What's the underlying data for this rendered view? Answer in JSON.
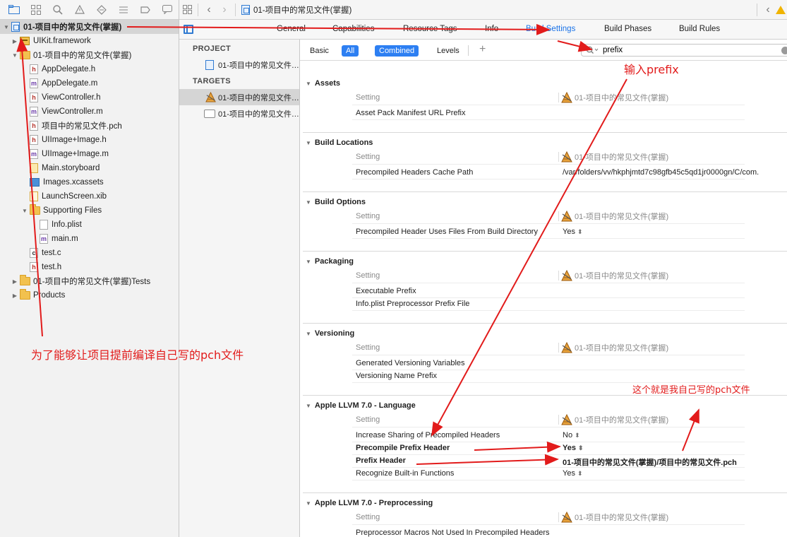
{
  "navigator": {
    "project_name": "01-项目中的常见文件(掌握)",
    "items": [
      {
        "label": "01-项目中的常见文件(掌握)",
        "type": "project",
        "disclosure": "▼",
        "selected": true
      },
      {
        "label": "UIKit.framework",
        "type": "framework",
        "disclosure": "▶"
      },
      {
        "label": "01-项目中的常见文件(掌握)",
        "type": "folder",
        "disclosure": "▼"
      },
      {
        "label": "AppDelegate.h",
        "type": "h"
      },
      {
        "label": "AppDelegate.m",
        "type": "m"
      },
      {
        "label": "ViewController.h",
        "type": "h"
      },
      {
        "label": "ViewController.m",
        "type": "m"
      },
      {
        "label": "项目中的常见文件.pch",
        "type": "h"
      },
      {
        "label": "UIImage+Image.h",
        "type": "h"
      },
      {
        "label": "UIImage+Image.m",
        "type": "m"
      },
      {
        "label": "Main.storyboard",
        "type": "storyboard"
      },
      {
        "label": "Images.xcassets",
        "type": "assets"
      },
      {
        "label": "LaunchScreen.xib",
        "type": "xib"
      },
      {
        "label": "Supporting Files",
        "type": "folder",
        "disclosure": "▼"
      },
      {
        "label": "Info.plist",
        "type": "plist"
      },
      {
        "label": "main.m",
        "type": "m"
      },
      {
        "label": "test.c",
        "type": "c"
      },
      {
        "label": "test.h",
        "type": "h"
      },
      {
        "label": "01-项目中的常见文件(掌握)Tests",
        "type": "folder",
        "disclosure": "▶"
      },
      {
        "label": "Products",
        "type": "folder",
        "disclosure": "▶"
      }
    ]
  },
  "jump_bar": {
    "path": "01-项目中的常见文件(掌握)"
  },
  "tabs": [
    "General",
    "Capabilities",
    "Resource Tags",
    "Info",
    "Build Settings",
    "Build Phases",
    "Build Rules"
  ],
  "targets_panel": {
    "project_header": "PROJECT",
    "project_item": "01-项目中的常见文件(...",
    "targets_header": "TARGETS",
    "target_items": [
      "01-项目中的常见文件(...",
      "01-项目中的常见文件(..."
    ]
  },
  "filter_bar": {
    "basic": "Basic",
    "all": "All",
    "combined": "Combined",
    "levels": "Levels",
    "plus": "+",
    "search_value": "prefix"
  },
  "settings": {
    "col_setting": "Setting",
    "col_target": "01-项目中的常见文件(掌握)",
    "sections": [
      {
        "title": "Assets",
        "rows": [
          {
            "name": "Asset Pack Manifest URL Prefix",
            "value": ""
          }
        ]
      },
      {
        "title": "Build Locations",
        "rows": [
          {
            "name": "Precompiled Headers Cache Path",
            "value": "/var/folders/vv/hkphjmtd7c98gfb45c5qd1jr0000gn/C/com."
          }
        ]
      },
      {
        "title": "Build Options",
        "rows": [
          {
            "name": "Precompiled Header Uses Files From Build Directory",
            "value": "Yes"
          }
        ]
      },
      {
        "title": "Packaging",
        "rows": [
          {
            "name": "Executable Prefix",
            "value": ""
          },
          {
            "name": "Info.plist Preprocessor Prefix File",
            "value": ""
          }
        ]
      },
      {
        "title": "Versioning",
        "rows": [
          {
            "name": "Generated Versioning Variables",
            "value": ""
          },
          {
            "name": "Versioning Name Prefix",
            "value": ""
          }
        ]
      },
      {
        "title": "Apple LLVM 7.0 - Language",
        "rows": [
          {
            "name": "Increase Sharing of Precompiled Headers",
            "value": "No"
          },
          {
            "name": "Precompile Prefix Header",
            "value": "Yes",
            "bold": true
          },
          {
            "name": "Prefix Header",
            "value": "01-项目中的常见文件(掌握)/项目中的常见文件.pch",
            "bold": true
          },
          {
            "name": "Recognize Built-in Functions",
            "value": "Yes"
          }
        ]
      },
      {
        "title": "Apple LLVM 7.0 - Preprocessing",
        "rows": [
          {
            "name": "Preprocessor Macros Not Used In Precompiled Headers",
            "value": ""
          }
        ]
      }
    ]
  },
  "annotations": {
    "input_prefix": "输入prefix",
    "reason": "为了能够让项目提前编译自己写的pch文件",
    "own_pch": "这个就是我自己写的pch文件"
  },
  "colors": {
    "accent": "#1a73e8",
    "annotation": "#e21b1b",
    "selected_segment": "#2d7ff2"
  }
}
